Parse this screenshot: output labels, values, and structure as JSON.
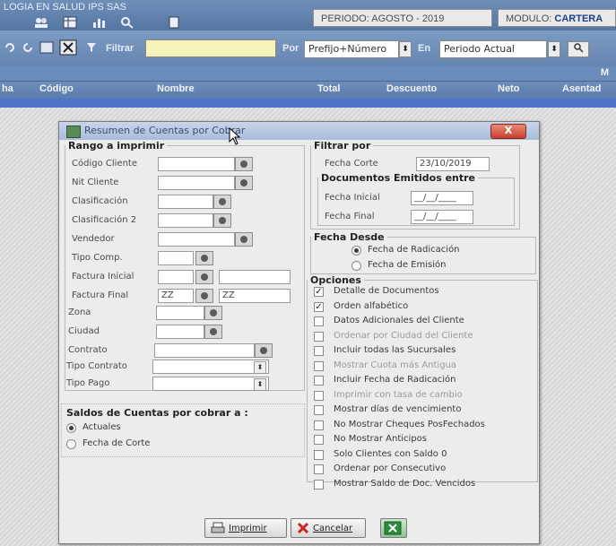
{
  "app": {
    "title": "LOGIA EN SALUD IPS SAS",
    "period_label": "PERIODO: AGOSTO - 2019",
    "module_label": "MODULO:",
    "module_value": "CARTERA"
  },
  "toolbar": {
    "filter_label": "Filtrar",
    "filter_value": "",
    "por_label": "Por",
    "por_value": "Prefijo+Número",
    "en_label": "En",
    "en_value": "Periodo Actual"
  },
  "grid": {
    "columns": [
      "ha",
      "Código",
      "Nombre",
      "Total",
      "Descuento",
      "Neto",
      "Asentad"
    ],
    "extra": "M"
  },
  "dialog": {
    "title": "Resumen de Cuentas por Cobrar",
    "close_label": "X",
    "rango": {
      "legend": "Rango a imprimir",
      "codigo_cliente": "Código Cliente",
      "nit_cliente": "Nit Cliente",
      "clasificacion": "Clasificación",
      "clasificacion2": "Clasificación 2",
      "vendedor": "Vendedor",
      "tipo_comp": "Tipo Comp.",
      "factura_inicial": "Factura Inicial",
      "factura_final": "Factura Final",
      "factura_final_prefix": "ZZ",
      "factura_final_value": "ZZ",
      "zona": "Zona",
      "ciudad": "Ciudad",
      "contrato": "Contrato",
      "tipo_contrato": "Tipo Contrato",
      "tipo_pago": "Tipo Pago"
    },
    "saldos": {
      "legend": "Saldos de Cuentas por cobrar a :",
      "opt1": "Actuales",
      "opt2": "Fecha de Corte",
      "selected": "Actuales"
    },
    "filtrar": {
      "legend": "Filtrar por",
      "fecha_corte_label": "Fecha Corte",
      "fecha_corte_value": "23/10/2019",
      "docs_legend": "Documentos Emitidos entre",
      "fecha_inicial_label": "Fecha Inicial",
      "fecha_inicial_value": "__/__/____",
      "fecha_final_label": "Fecha Final",
      "fecha_final_value": "__/__/____"
    },
    "fecha_desde": {
      "legend": "Fecha Desde",
      "opt1": "Fecha de Radicación",
      "opt2": "Fecha de Emisión",
      "selected": "Fecha de Radicación"
    },
    "opciones": {
      "legend": "Opciones",
      "items": [
        {
          "label": "Detalle de Documentos",
          "checked": true,
          "enabled": true
        },
        {
          "label": "Orden alfabético",
          "checked": true,
          "enabled": true
        },
        {
          "label": "Datos Adicionales del Cliente",
          "checked": false,
          "enabled": true
        },
        {
          "label": "Ordenar por Ciudad del Cliente",
          "checked": false,
          "enabled": false
        },
        {
          "label": "Incluir todas las Sucursales",
          "checked": false,
          "enabled": true
        },
        {
          "label": "Mostrar Cuota más Antigua",
          "checked": false,
          "enabled": false
        },
        {
          "label": "Incluir Fecha de Radicación",
          "checked": false,
          "enabled": true
        },
        {
          "label": "Imprimir con tasa de cambio",
          "checked": false,
          "enabled": false
        },
        {
          "label": "Mostrar días de vencimiento",
          "checked": false,
          "enabled": true
        },
        {
          "label": "No Mostrar Cheques PosFechados",
          "checked": false,
          "enabled": true
        },
        {
          "label": "No Mostrar Anticipos",
          "checked": false,
          "enabled": true
        },
        {
          "label": "Solo Clientes con Saldo 0",
          "checked": false,
          "enabled": true
        },
        {
          "label": "Ordenar por Consecutivo",
          "checked": false,
          "enabled": true
        },
        {
          "label": "Mostrar Saldo de Doc. Vencidos",
          "checked": false,
          "enabled": true
        }
      ]
    },
    "buttons": {
      "imprimir": "Imprimir",
      "cancelar": "Cancelar"
    }
  },
  "colors": {
    "accent": "#5576a3",
    "grid_selected_row": "#4f74c9",
    "close_button": "#c9412f"
  }
}
